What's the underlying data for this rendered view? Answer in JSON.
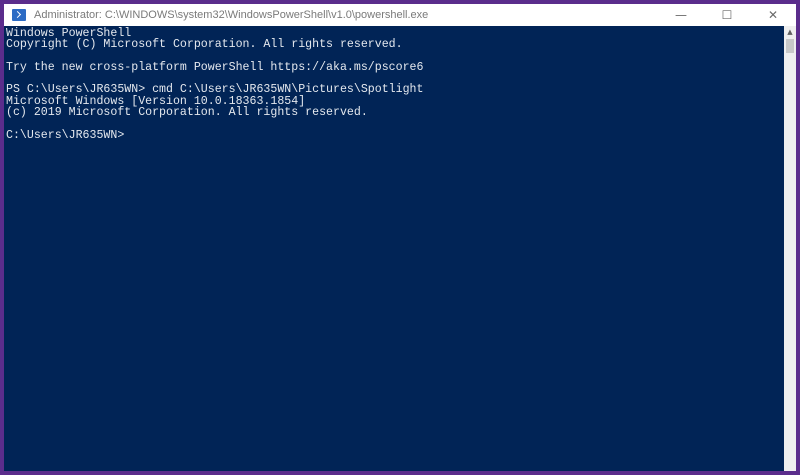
{
  "window": {
    "title": "Administrator: C:\\WINDOWS\\system32\\WindowsPowerShell\\v1.0\\powershell.exe",
    "app_icon": "powershell-icon",
    "controls": {
      "minimize": "—",
      "maximize": "☐",
      "close": "✕"
    }
  },
  "colors": {
    "console_background": "#012456",
    "console_text": "#e4e8ee",
    "outer_border": "#5b2d8c"
  },
  "console": {
    "lines": [
      "Windows PowerShell",
      "Copyright (C) Microsoft Corporation. All rights reserved.",
      "",
      "Try the new cross-platform PowerShell https://aka.ms/pscore6",
      "",
      "PS C:\\Users\\JR635WN> cmd C:\\Users\\JR635WN\\Pictures\\Spotlight",
      "Microsoft Windows [Version 10.0.18363.1854]",
      "(c) 2019 Microsoft Corporation. All rights reserved.",
      "",
      "C:\\Users\\JR635WN>"
    ]
  },
  "scrollbar": {
    "up_arrow": "▲"
  }
}
